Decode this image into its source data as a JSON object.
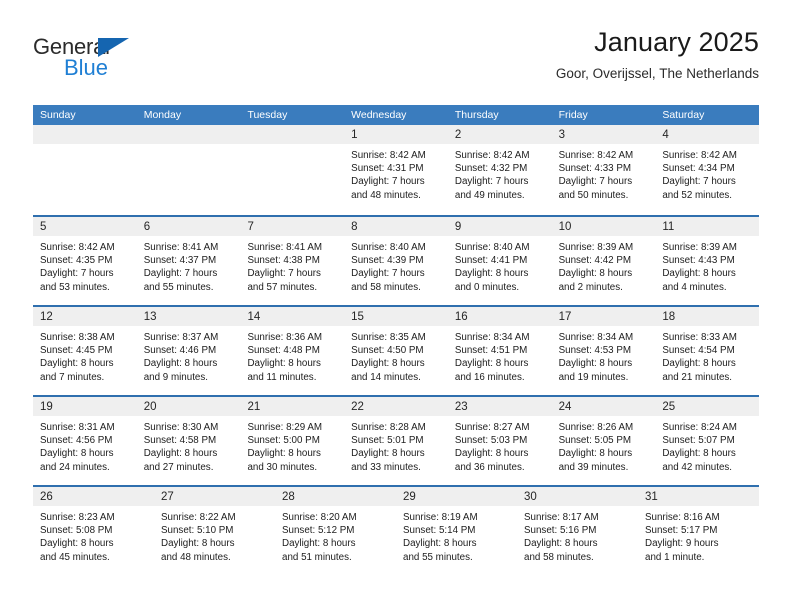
{
  "brand": {
    "name_part1": "General",
    "name_part2": "Blue",
    "triangle_icon": "blue-triangle-logo-mark",
    "colors": {
      "dark_text": "#2b2b2b",
      "blue": "#1f7fd4",
      "triangle": "#1565b0"
    }
  },
  "header": {
    "title": "January 2025",
    "subtitle": "Goor, Overijssel, The Netherlands"
  },
  "theme": {
    "header_blue": "#3a7cbe",
    "row_divider_blue": "#2f6fae",
    "daynum_band": "#efefef",
    "text": "#1d1d1d"
  },
  "weekdays": [
    "Sunday",
    "Monday",
    "Tuesday",
    "Wednesday",
    "Thursday",
    "Friday",
    "Saturday"
  ],
  "weeks": [
    [
      {
        "day": "",
        "lines": []
      },
      {
        "day": "",
        "lines": []
      },
      {
        "day": "",
        "lines": []
      },
      {
        "day": "1",
        "lines": [
          "Sunrise: 8:42 AM",
          "Sunset: 4:31 PM",
          "Daylight: 7 hours",
          "and 48 minutes."
        ]
      },
      {
        "day": "2",
        "lines": [
          "Sunrise: 8:42 AM",
          "Sunset: 4:32 PM",
          "Daylight: 7 hours",
          "and 49 minutes."
        ]
      },
      {
        "day": "3",
        "lines": [
          "Sunrise: 8:42 AM",
          "Sunset: 4:33 PM",
          "Daylight: 7 hours",
          "and 50 minutes."
        ]
      },
      {
        "day": "4",
        "lines": [
          "Sunrise: 8:42 AM",
          "Sunset: 4:34 PM",
          "Daylight: 7 hours",
          "and 52 minutes."
        ]
      }
    ],
    [
      {
        "day": "5",
        "lines": [
          "Sunrise: 8:42 AM",
          "Sunset: 4:35 PM",
          "Daylight: 7 hours",
          "and 53 minutes."
        ]
      },
      {
        "day": "6",
        "lines": [
          "Sunrise: 8:41 AM",
          "Sunset: 4:37 PM",
          "Daylight: 7 hours",
          "and 55 minutes."
        ]
      },
      {
        "day": "7",
        "lines": [
          "Sunrise: 8:41 AM",
          "Sunset: 4:38 PM",
          "Daylight: 7 hours",
          "and 57 minutes."
        ]
      },
      {
        "day": "8",
        "lines": [
          "Sunrise: 8:40 AM",
          "Sunset: 4:39 PM",
          "Daylight: 7 hours",
          "and 58 minutes."
        ]
      },
      {
        "day": "9",
        "lines": [
          "Sunrise: 8:40 AM",
          "Sunset: 4:41 PM",
          "Daylight: 8 hours",
          "and 0 minutes."
        ]
      },
      {
        "day": "10",
        "lines": [
          "Sunrise: 8:39 AM",
          "Sunset: 4:42 PM",
          "Daylight: 8 hours",
          "and 2 minutes."
        ]
      },
      {
        "day": "11",
        "lines": [
          "Sunrise: 8:39 AM",
          "Sunset: 4:43 PM",
          "Daylight: 8 hours",
          "and 4 minutes."
        ]
      }
    ],
    [
      {
        "day": "12",
        "lines": [
          "Sunrise: 8:38 AM",
          "Sunset: 4:45 PM",
          "Daylight: 8 hours",
          "and 7 minutes."
        ]
      },
      {
        "day": "13",
        "lines": [
          "Sunrise: 8:37 AM",
          "Sunset: 4:46 PM",
          "Daylight: 8 hours",
          "and 9 minutes."
        ]
      },
      {
        "day": "14",
        "lines": [
          "Sunrise: 8:36 AM",
          "Sunset: 4:48 PM",
          "Daylight: 8 hours",
          "and 11 minutes."
        ]
      },
      {
        "day": "15",
        "lines": [
          "Sunrise: 8:35 AM",
          "Sunset: 4:50 PM",
          "Daylight: 8 hours",
          "and 14 minutes."
        ]
      },
      {
        "day": "16",
        "lines": [
          "Sunrise: 8:34 AM",
          "Sunset: 4:51 PM",
          "Daylight: 8 hours",
          "and 16 minutes."
        ]
      },
      {
        "day": "17",
        "lines": [
          "Sunrise: 8:34 AM",
          "Sunset: 4:53 PM",
          "Daylight: 8 hours",
          "and 19 minutes."
        ]
      },
      {
        "day": "18",
        "lines": [
          "Sunrise: 8:33 AM",
          "Sunset: 4:54 PM",
          "Daylight: 8 hours",
          "and 21 minutes."
        ]
      }
    ],
    [
      {
        "day": "19",
        "lines": [
          "Sunrise: 8:31 AM",
          "Sunset: 4:56 PM",
          "Daylight: 8 hours",
          "and 24 minutes."
        ]
      },
      {
        "day": "20",
        "lines": [
          "Sunrise: 8:30 AM",
          "Sunset: 4:58 PM",
          "Daylight: 8 hours",
          "and 27 minutes."
        ]
      },
      {
        "day": "21",
        "lines": [
          "Sunrise: 8:29 AM",
          "Sunset: 5:00 PM",
          "Daylight: 8 hours",
          "and 30 minutes."
        ]
      },
      {
        "day": "22",
        "lines": [
          "Sunrise: 8:28 AM",
          "Sunset: 5:01 PM",
          "Daylight: 8 hours",
          "and 33 minutes."
        ]
      },
      {
        "day": "23",
        "lines": [
          "Sunrise: 8:27 AM",
          "Sunset: 5:03 PM",
          "Daylight: 8 hours",
          "and 36 minutes."
        ]
      },
      {
        "day": "24",
        "lines": [
          "Sunrise: 8:26 AM",
          "Sunset: 5:05 PM",
          "Daylight: 8 hours",
          "and 39 minutes."
        ]
      },
      {
        "day": "25",
        "lines": [
          "Sunrise: 8:24 AM",
          "Sunset: 5:07 PM",
          "Daylight: 8 hours",
          "and 42 minutes."
        ]
      }
    ],
    [
      {
        "day": "26",
        "lines": [
          "Sunrise: 8:23 AM",
          "Sunset: 5:08 PM",
          "Daylight: 8 hours",
          "and 45 minutes."
        ]
      },
      {
        "day": "27",
        "lines": [
          "Sunrise: 8:22 AM",
          "Sunset: 5:10 PM",
          "Daylight: 8 hours",
          "and 48 minutes."
        ]
      },
      {
        "day": "28",
        "lines": [
          "Sunrise: 8:20 AM",
          "Sunset: 5:12 PM",
          "Daylight: 8 hours",
          "and 51 minutes."
        ]
      },
      {
        "day": "29",
        "lines": [
          "Sunrise: 8:19 AM",
          "Sunset: 5:14 PM",
          "Daylight: 8 hours",
          "and 55 minutes."
        ]
      },
      {
        "day": "30",
        "lines": [
          "Sunrise: 8:17 AM",
          "Sunset: 5:16 PM",
          "Daylight: 8 hours",
          "and 58 minutes."
        ]
      },
      {
        "day": "31",
        "lines": [
          "Sunrise: 8:16 AM",
          "Sunset: 5:17 PM",
          "Daylight: 9 hours",
          "and 1 minute."
        ]
      }
    ]
  ]
}
